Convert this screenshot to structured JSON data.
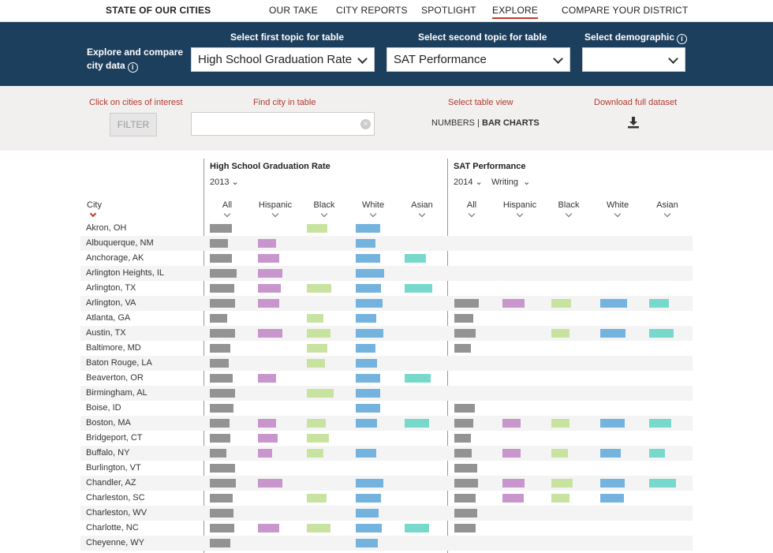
{
  "nav": {
    "brand": "STATE OF OUR CITIES",
    "items": [
      "OUR TAKE",
      "CITY REPORTS",
      "SPOTLIGHT",
      "EXPLORE",
      "COMPARE YOUR DISTRICT"
    ],
    "active": "EXPLORE"
  },
  "topics": {
    "intro": "Explore and compare city data",
    "first_label": "Select first topic for table",
    "first_value": "High School Graduation Rate",
    "second_label": "Select second topic for table",
    "second_value": "SAT Performance",
    "demo_label": "Select demographic",
    "demo_value": ""
  },
  "tools": {
    "click_label": "Click on cities of interest",
    "filter_label": "FILTER",
    "find_label": "Find city in table",
    "find_value": "",
    "view_label": "Select table view",
    "view_numbers": "NUMBERS",
    "view_sep": "|",
    "view_bars": "BAR CHARTS",
    "download_label": "Download full dataset"
  },
  "table": {
    "city_header": "City",
    "group1": {
      "title": "High School Graduation Rate",
      "year": "2013"
    },
    "group2": {
      "title": "SAT Performance",
      "year": "2014",
      "subject": "Writing"
    },
    "columns": [
      "All",
      "Hispanic",
      "Black",
      "White",
      "Asian"
    ],
    "colors": {
      "all": "#939393",
      "hispanic": "#c896cc",
      "black": "#c8e3a0",
      "white": "#75b3df",
      "asian": "#77d9cb"
    },
    "rows": [
      {
        "city": "Akron, OH",
        "g": [
          0.62,
          null,
          0.58,
          0.68,
          null
        ],
        "s": [
          null,
          null,
          null,
          null,
          null
        ]
      },
      {
        "city": "Albuquerque, NM",
        "g": [
          0.52,
          0.5,
          null,
          0.55,
          null
        ],
        "s": [
          null,
          null,
          null,
          null,
          null
        ]
      },
      {
        "city": "Anchorage, AK",
        "g": [
          0.62,
          0.6,
          null,
          0.68,
          0.6
        ],
        "s": [
          null,
          null,
          null,
          null,
          null
        ]
      },
      {
        "city": "Arlington Heights, IL",
        "g": [
          0.76,
          0.7,
          null,
          0.8,
          null
        ],
        "s": [
          null,
          null,
          null,
          null,
          null
        ]
      },
      {
        "city": "Arlington, TX",
        "g": [
          0.68,
          0.64,
          0.68,
          0.72,
          0.78
        ],
        "s": [
          null,
          null,
          null,
          null,
          null
        ]
      },
      {
        "city": "Arlington, VA",
        "g": [
          0.72,
          0.6,
          null,
          0.76,
          null
        ],
        "s": [
          0.68,
          0.62,
          0.55,
          0.76,
          0.56
        ]
      },
      {
        "city": "Atlanta, GA",
        "g": [
          0.48,
          null,
          0.46,
          0.58,
          null
        ],
        "s": [
          0.54,
          null,
          null,
          null,
          null
        ]
      },
      {
        "city": "Austin, TX",
        "g": [
          0.72,
          0.68,
          0.66,
          0.78,
          null
        ],
        "s": [
          0.6,
          null,
          0.52,
          0.72,
          0.68
        ]
      },
      {
        "city": "Baltimore, MD",
        "g": [
          0.58,
          null,
          0.58,
          0.56,
          null
        ],
        "s": [
          0.46,
          null,
          null,
          null,
          null
        ]
      },
      {
        "city": "Baton Rouge, LA",
        "g": [
          0.54,
          null,
          0.52,
          0.6,
          null
        ],
        "s": [
          null,
          null,
          null,
          null,
          null
        ]
      },
      {
        "city": "Beaverton, OR",
        "g": [
          0.64,
          0.5,
          null,
          0.68,
          0.74
        ],
        "s": [
          null,
          null,
          null,
          null,
          null
        ]
      },
      {
        "city": "Birmingham, AL",
        "g": [
          0.72,
          null,
          0.76,
          0.7,
          null
        ],
        "s": [
          null,
          null,
          null,
          null,
          null
        ]
      },
      {
        "city": "Boise, ID",
        "g": [
          0.66,
          null,
          null,
          0.68,
          null
        ],
        "s": [
          0.58,
          null,
          null,
          null,
          null
        ]
      },
      {
        "city": "Boston, MA",
        "g": [
          0.56,
          0.5,
          0.54,
          0.6,
          0.7
        ],
        "s": [
          0.54,
          0.5,
          0.5,
          0.7,
          0.62
        ]
      },
      {
        "city": "Bridgeport, CT",
        "g": [
          0.58,
          0.56,
          0.62,
          null,
          null
        ],
        "s": [
          0.46,
          null,
          null,
          null,
          null
        ]
      },
      {
        "city": "Buffalo, NY",
        "g": [
          0.46,
          0.4,
          0.46,
          0.58,
          null
        ],
        "s": [
          0.48,
          0.5,
          0.46,
          0.58,
          0.44
        ]
      },
      {
        "city": "Burlington, VT",
        "g": [
          0.72,
          null,
          null,
          null,
          null
        ],
        "s": [
          0.64,
          null,
          null,
          null,
          null
        ]
      },
      {
        "city": "Chandler, AZ",
        "g": [
          0.74,
          0.7,
          null,
          0.78,
          null
        ],
        "s": [
          0.66,
          0.62,
          0.6,
          0.68,
          0.76
        ]
      },
      {
        "city": "Charleston, SC",
        "g": [
          0.64,
          null,
          0.56,
          0.72,
          null
        ],
        "s": [
          0.6,
          0.6,
          0.5,
          0.66,
          null
        ]
      },
      {
        "city": "Charleston, WV",
        "g": [
          0.66,
          null,
          null,
          0.64,
          null
        ],
        "s": [
          0.64,
          null,
          null,
          null,
          null
        ]
      },
      {
        "city": "Charlotte, NC",
        "g": [
          0.68,
          0.6,
          0.66,
          0.74,
          0.7
        ],
        "s": [
          0.6,
          null,
          null,
          null,
          null
        ]
      },
      {
        "city": "Cheyenne, WY",
        "g": [
          0.58,
          null,
          null,
          0.62,
          null
        ],
        "s": [
          null,
          null,
          null,
          null,
          null
        ]
      }
    ]
  }
}
